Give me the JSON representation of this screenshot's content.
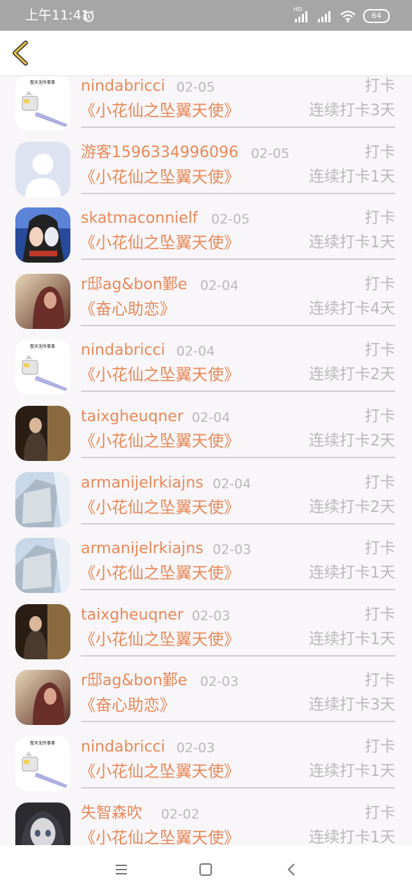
{
  "status_bar": {
    "time": "上午11:41",
    "network_badge": "HD",
    "battery": "64",
    "icons": [
      "alarm-icon",
      "signal-icon",
      "signal-icon",
      "wifi-icon",
      "battery-icon"
    ]
  },
  "header": {
    "back_icon": "chevron-left-icon",
    "accent": "#c9a227"
  },
  "colors": {
    "accent": "#e8895a",
    "muted": "#b9b9b9"
  },
  "entries": [
    {
      "name": "nindabricci",
      "date": "02-05",
      "action": "打卡",
      "book": "《小花仙之坠翼天使》",
      "streak": "连续打卡3天",
      "avatar": "avatar-shovel"
    },
    {
      "name": "游客1596334996096",
      "date": "02-05",
      "action": "打卡",
      "book": "《小花仙之坠翼天使》",
      "streak": "连续打卡1天",
      "avatar": "avatar-default"
    },
    {
      "name": "skatmaconnielf",
      "date": "02-05",
      "action": "打卡",
      "book": "《小花仙之坠翼天使》",
      "streak": "连续打卡1天",
      "avatar": "avatar-anime-blue"
    },
    {
      "name": "r邸ag&bon鄞e",
      "date": "02-04",
      "action": "打卡",
      "book": "《奋心助恋》",
      "streak": "连续打卡4天",
      "avatar": "avatar-girl-brown"
    },
    {
      "name": "nindabricci",
      "date": "02-04",
      "action": "打卡",
      "book": "《小花仙之坠翼天使》",
      "streak": "连续打卡2天",
      "avatar": "avatar-shovel"
    },
    {
      "name": "taixgheuqner",
      "date": "02-04",
      "action": "打卡",
      "book": "《小花仙之坠翼天使》",
      "streak": "连续打卡2天",
      "avatar": "avatar-lady-dark"
    },
    {
      "name": "armanijelrkiajns",
      "date": "02-04",
      "action": "打卡",
      "book": "《小花仙之坠翼天使》",
      "streak": "连续打卡2天",
      "avatar": "avatar-ice"
    },
    {
      "name": "armanijelrkiajns",
      "date": "02-03",
      "action": "打卡",
      "book": "《小花仙之坠翼天使》",
      "streak": "连续打卡1天",
      "avatar": "avatar-ice"
    },
    {
      "name": "taixgheuqner",
      "date": "02-03",
      "action": "打卡",
      "book": "《小花仙之坠翼天使》",
      "streak": "连续打卡1天",
      "avatar": "avatar-lady-dark"
    },
    {
      "name": "r邸ag&bon鄞e",
      "date": "02-03",
      "action": "打卡",
      "book": "《奋心助恋》",
      "streak": "连续打卡3天",
      "avatar": "avatar-girl-brown"
    },
    {
      "name": "nindabricci",
      "date": "02-03",
      "action": "打卡",
      "book": "《小花仙之坠翼天使》",
      "streak": "连续打卡1天",
      "avatar": "avatar-shovel"
    },
    {
      "name": "失智森吹",
      "date": "02-02",
      "action": "打卡",
      "book": "《小花仙之坠翼天使》",
      "streak": "连续打卡1天",
      "avatar": "avatar-anime-gray"
    }
  ],
  "nav_bar": {
    "icons": [
      "menu-icon",
      "home-icon",
      "back-icon"
    ]
  }
}
